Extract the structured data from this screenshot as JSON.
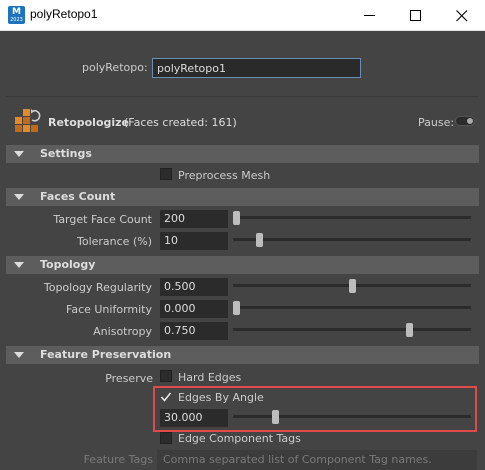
{
  "window": {
    "title": "polyRetopo1",
    "app_icon_letter": "M",
    "app_icon_sub": "2023"
  },
  "node": {
    "name_label": "polyRetopo:",
    "name_value": "polyRetopo1",
    "title": "Retopologize",
    "status": "(Faces created: 161)",
    "pause_label": "Pause:",
    "pause_on": false
  },
  "sections": {
    "settings": "Settings",
    "faces_count": "Faces Count",
    "topology": "Topology",
    "feature_preservation": "Feature Preservation"
  },
  "settings": {
    "preprocess_mesh": {
      "label": "Preprocess Mesh",
      "checked": false
    }
  },
  "faces_count": {
    "target_face_count": {
      "label": "Target Face Count",
      "value": "200",
      "slider": 0.0
    },
    "tolerance": {
      "label": "Tolerance (%)",
      "value": "10",
      "slider": 0.1
    }
  },
  "topology": {
    "regularity": {
      "label": "Topology Regularity",
      "value": "0.500",
      "slider": 0.5
    },
    "uniformity": {
      "label": "Face Uniformity",
      "value": "0.000",
      "slider": 0.0
    },
    "anisotropy": {
      "label": "Anisotropy",
      "value": "0.750",
      "slider": 0.75
    }
  },
  "feature_preservation": {
    "preserve_label": "Preserve",
    "hard_edges": {
      "label": "Hard Edges",
      "checked": false
    },
    "edges_by_angle": {
      "label": "Edges By Angle",
      "checked": true,
      "value": "30.000",
      "slider": 0.17
    },
    "edge_component_tags": {
      "label": "Edge Component Tags",
      "checked": false
    },
    "feature_tags_label": "Feature Tags",
    "feature_tags_placeholder": "Comma separated list of Component Tag names."
  },
  "colors": {
    "highlight_border": "#e14a4a",
    "panel_bg": "#444444",
    "section_bg": "#5d5d5d"
  },
  "icons": [
    "app-icon",
    "minimize-icon",
    "maximize-icon",
    "close-icon",
    "retopo-node-icon",
    "collapse-triangle-icon",
    "checkmark-icon"
  ]
}
